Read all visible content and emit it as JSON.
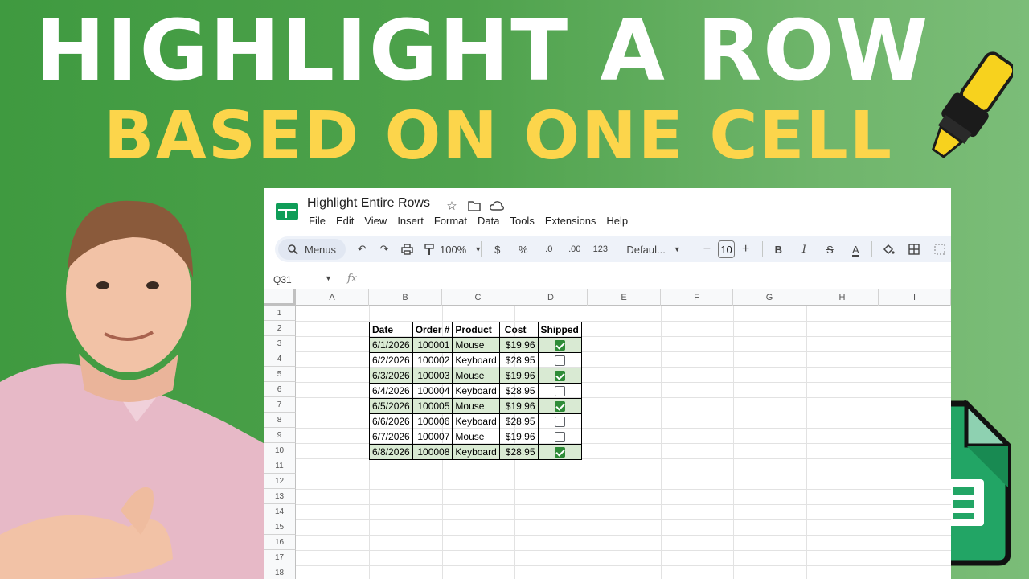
{
  "headline": {
    "line1": "HIGHLIGHT A ROW",
    "line2": "BASED ON ONE CELL"
  },
  "colors": {
    "headline1": "#ffffff",
    "headline2": "#fcd54b",
    "highlight_row": "#d9ead3",
    "checkbox_checked": "#2e8b37",
    "background": "#4ea24c"
  },
  "window": {
    "title": "Highlight Entire Rows",
    "title_icons": [
      "star-icon",
      "move-to-folder-icon",
      "cloud-saved-icon"
    ],
    "menu": [
      "File",
      "Edit",
      "View",
      "Insert",
      "Format",
      "Data",
      "Tools",
      "Extensions",
      "Help"
    ],
    "toolbar": {
      "search_label": "Menus",
      "zoom": "100%",
      "currency": "$",
      "percent": "%",
      "decrease_decimal": ".0",
      "increase_decimal": ".00",
      "number_format": "123",
      "font": "Defaul...",
      "font_size": "10",
      "minus": "−",
      "plus": "+",
      "bold": "B",
      "italic": "I",
      "strike": "S",
      "text_color": "A"
    },
    "name_box": "Q31",
    "fx": "fx"
  },
  "sheet": {
    "columns": [
      "A",
      "B",
      "C",
      "D",
      "E",
      "F",
      "G",
      "H",
      "I"
    ],
    "rows": [
      "1",
      "2",
      "3",
      "4",
      "5",
      "6",
      "7",
      "8",
      "9",
      "10",
      "11",
      "12",
      "13",
      "14",
      "15",
      "16",
      "17",
      "18"
    ],
    "table": {
      "headers": [
        "Date",
        "Order #",
        "Product",
        "Cost",
        "Shipped"
      ],
      "data": [
        {
          "date": "6/1/2026",
          "order": "100001",
          "product": "Mouse",
          "currency": "$",
          "cost": "19.96",
          "shipped": true
        },
        {
          "date": "6/2/2026",
          "order": "100002",
          "product": "Keyboard",
          "currency": "$",
          "cost": "28.95",
          "shipped": false
        },
        {
          "date": "6/3/2026",
          "order": "100003",
          "product": "Mouse",
          "currency": "$",
          "cost": "19.96",
          "shipped": true
        },
        {
          "date": "6/4/2026",
          "order": "100004",
          "product": "Keyboard",
          "currency": "$",
          "cost": "28.95",
          "shipped": false
        },
        {
          "date": "6/5/2026",
          "order": "100005",
          "product": "Mouse",
          "currency": "$",
          "cost": "19.96",
          "shipped": true
        },
        {
          "date": "6/6/2026",
          "order": "100006",
          "product": "Keyboard",
          "currency": "$",
          "cost": "28.95",
          "shipped": false
        },
        {
          "date": "6/7/2026",
          "order": "100007",
          "product": "Mouse",
          "currency": "$",
          "cost": "19.96",
          "shipped": false
        },
        {
          "date": "6/8/2026",
          "order": "100008",
          "product": "Keyboard",
          "currency": "$",
          "cost": "28.95",
          "shipped": true
        }
      ]
    }
  }
}
